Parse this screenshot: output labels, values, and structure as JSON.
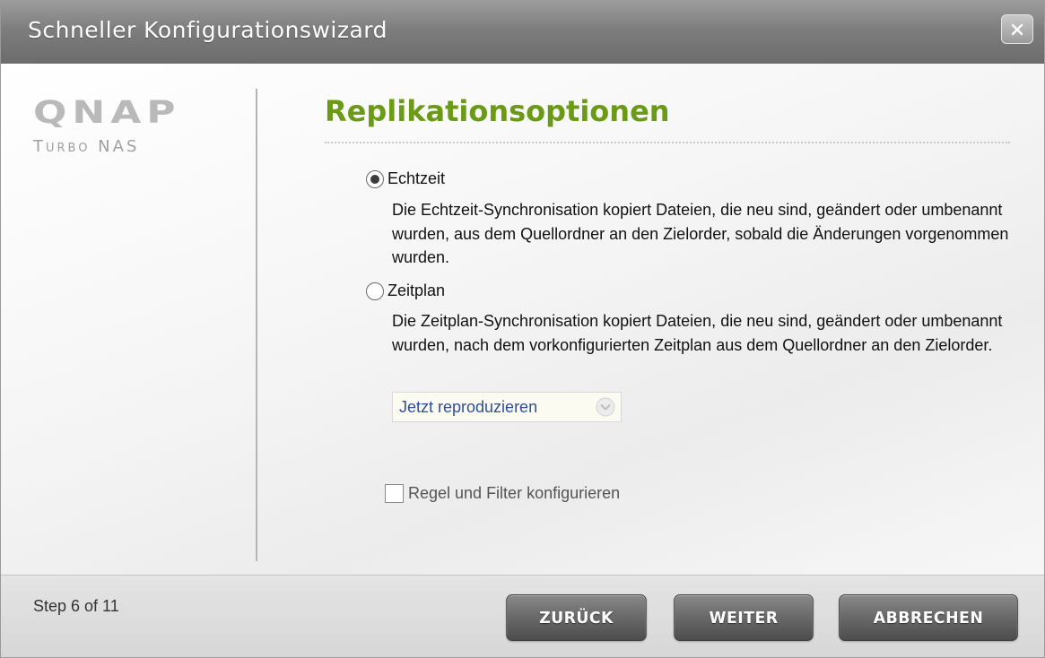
{
  "window": {
    "title": "Schneller Konfigurationswizard"
  },
  "sidebar": {
    "brand": "QNAP",
    "subtitle": "Turbo NAS"
  },
  "main": {
    "heading": "Replikationsoptionen",
    "options": [
      {
        "label": "Echtzeit",
        "selected": true,
        "description": "Die Echtzeit-Synchronisation kopiert Dateien, die neu sind, geändert oder umbenannt wurden, aus dem Quellordner an den Zielorder, sobald die Änderungen vorgenommen wurden."
      },
      {
        "label": "Zeitplan",
        "selected": false,
        "description": "Die Zeitplan-Synchronisation kopiert Dateien, die neu sind, geändert oder umbenannt wurden, nach dem vorkonfigurierten Zeitplan aus dem Quellordner an den Zielorder."
      }
    ],
    "schedule_select": {
      "value": "Jetzt reproduzieren"
    },
    "rule_filter_checkbox": {
      "label": "Regel und Filter konfigurieren",
      "checked": false
    }
  },
  "footer": {
    "step_text": "Step 6 of 11",
    "back_label": "ZURÜCK",
    "next_label": "WEITER",
    "cancel_label": "ABBRECHEN"
  },
  "colors": {
    "heading": "#6a9a16",
    "titlebar": "#7d7d7d",
    "button": "#5c5c5c",
    "select_value": "#2f4f9a"
  },
  "icons": {
    "close": "close-icon",
    "dropdown": "chevron-down-icon"
  }
}
